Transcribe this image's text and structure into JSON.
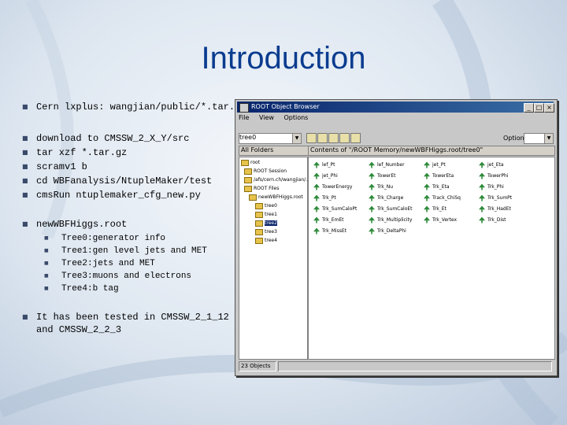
{
  "slide": {
    "title": "Introduction",
    "bullets": [
      {
        "text": "Cern lxplus: wangjian/public/*.tar.gz"
      },
      {
        "text": "download to CMSSW_2_X_Y/src"
      },
      {
        "text": "tar xzf *.tar.gz"
      },
      {
        "text": "scramv1 b"
      },
      {
        "text": "cd WBFanalysis/NtupleMaker/test"
      },
      {
        "text": "cmsRun ntuplemaker_cfg_new.py"
      },
      {
        "text": "newWBFHiggs.root"
      },
      {
        "text": "It has been tested in CMSSW_2_1_12"
      },
      {
        "text": "and CMSSW_2_2_3"
      }
    ],
    "sub_bullets": [
      "Tree0:generator info",
      "Tree1:gen level jets and MET",
      "Tree2:jets and MET",
      "Tree3:muons and electrons",
      "Tree4:b tag"
    ]
  },
  "browser": {
    "title": "ROOT Object Browser",
    "menu": [
      "File",
      "View",
      "Options"
    ],
    "combo_value": "tree0",
    "option_label": "Option",
    "tree_header": "All Folders",
    "contents_header": "Contents of \"/ROOT Memory/newWBFHiggs.root/tree0\"",
    "tree_items": [
      "root",
      "ROOT Session",
      "/afs/cern.ch/wangjian/...",
      "ROOT Files",
      "newWBFHiggs.root",
      "tree0",
      "tree1",
      "tree2",
      "tree3",
      "tree4"
    ],
    "leaves": [
      "lef_Pt",
      "lef_Number",
      "jet_Pt",
      "jet_Eta",
      "jet_Phi",
      "TowerEt",
      "TowerEta",
      "TowerPhi",
      "TowerEnergy",
      "Trk_Nu",
      "Trk_Eta",
      "Trk_Phi",
      "Trk_Pt",
      "Trk_Charge",
      "Track_ChiSq",
      "Trk_SumPt",
      "Trk_SumCaloPt",
      "Trk_SumCaloEt",
      "Trk_Et",
      "Trk_HadEt",
      "Trk_EmEt",
      "Trk_Multiplicity",
      "Trk_Vertex",
      "Trk_Dist",
      "Trk_MissEt",
      "Trk_DeltaPhi"
    ],
    "status": "23 Objects"
  }
}
